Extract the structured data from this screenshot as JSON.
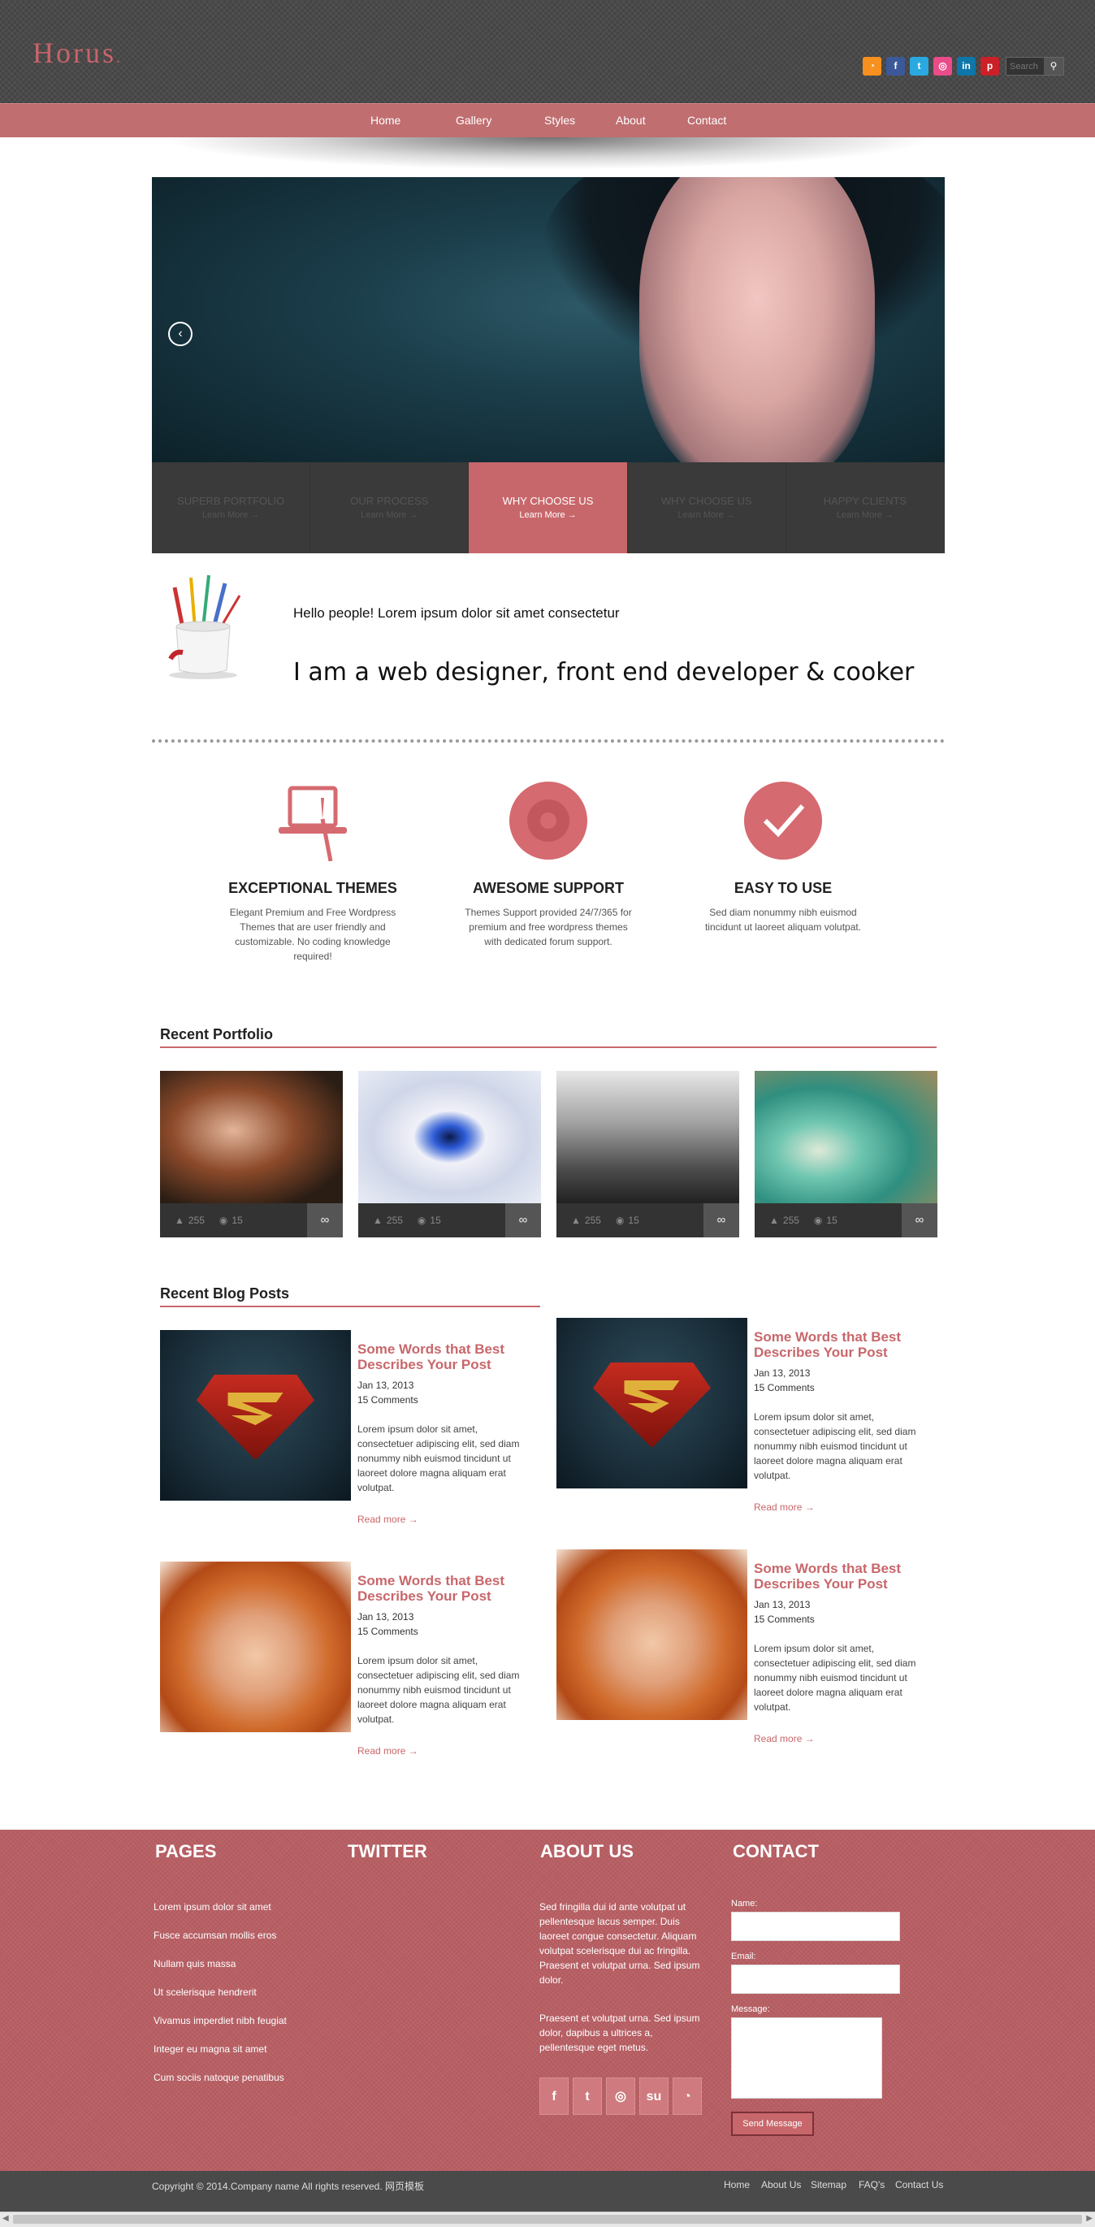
{
  "header": {
    "logo": "Horus",
    "search_placeholder": "Search",
    "social": [
      {
        "icon": "rss-icon",
        "glyph": "◔",
        "color": "#f7901e"
      },
      {
        "icon": "facebook-icon",
        "glyph": "f",
        "color": "#3b5998"
      },
      {
        "icon": "twitter-icon",
        "glyph": "t",
        "color": "#2aa9e0"
      },
      {
        "icon": "dribbble-icon",
        "glyph": "◎",
        "color": "#ea4c89"
      },
      {
        "icon": "linkedin-icon",
        "glyph": "in",
        "color": "#0e76a8"
      },
      {
        "icon": "pinterest-icon",
        "glyph": "p",
        "color": "#cb2027"
      }
    ]
  },
  "nav": [
    "Home",
    "Gallery",
    "Styles",
    "About",
    "Contact"
  ],
  "slider": {
    "prev_glyph": "‹",
    "tabs": [
      {
        "title": "SUPERB PORTFOLIO",
        "link": "Learn More →"
      },
      {
        "title": "OUR PROCESS",
        "link": "Learn More →"
      },
      {
        "title": "WHY CHOOSE US",
        "link": "Learn More →"
      },
      {
        "title": "WHY CHOOSE US",
        "link": "Learn More →"
      },
      {
        "title": "HAPPY CLIENTS",
        "link": "Learn More →"
      }
    ]
  },
  "intro": {
    "small": "Hello people! Lorem ipsum dolor sit amet consectetur",
    "big": "I am a web designer, front end developer & cooker"
  },
  "features": [
    {
      "title": "EXCEPTIONAL THEMES",
      "text": "Elegant Premium and Free Wordpress Themes that are user friendly and customizable. No coding knowledge required!"
    },
    {
      "title": "AWESOME SUPPORT",
      "text": "Themes Support provided 24/7/365 for premium and free wordpress themes with dedicated forum support."
    },
    {
      "title": "EASY TO USE",
      "text": "Sed diam nonummy nibh euismod tincidunt ut laoreet aliquam volutpat."
    }
  ],
  "portfolio": {
    "title": "Recent Portfolio",
    "items": [
      {
        "likes": "255",
        "views": "15"
      },
      {
        "likes": "255",
        "views": "15"
      },
      {
        "likes": "255",
        "views": "15"
      },
      {
        "likes": "255",
        "views": "15"
      }
    ]
  },
  "blog": {
    "title": "Recent Blog Posts",
    "posts": [
      {
        "title": "Some Words that Best Describes Your Post",
        "date": "Jan 13, 2013",
        "comments": "15 Comments",
        "text": "Lorem ipsum dolor sit amet, consectetuer adipiscing elit, sed diam nonummy nibh euismod tincidunt ut laoreet dolore magna aliquam erat volutpat.",
        "more": "Read more →"
      },
      {
        "title": "Some Words that Best Describes Your Post",
        "date": "Jan 13, 2013",
        "comments": "15 Comments",
        "text": "Lorem ipsum dolor sit amet, consectetuer adipiscing elit, sed diam nonummy nibh euismod tincidunt ut laoreet dolore magna aliquam erat volutpat.",
        "more": "Read more →"
      },
      {
        "title": "Some Words that Best Describes Your Post",
        "date": "Jan 13, 2013",
        "comments": "15 Comments",
        "text": "Lorem ipsum dolor sit amet, consectetuer adipiscing elit, sed diam nonummy nibh euismod tincidunt ut laoreet dolore magna aliquam erat volutpat.",
        "more": "Read more →"
      },
      {
        "title": "Some Words that Best Describes Your Post",
        "date": "Jan 13, 2013",
        "comments": "15 Comments",
        "text": "Lorem ipsum dolor sit amet, consectetuer adipiscing elit, sed diam nonummy nibh euismod tincidunt ut laoreet dolore magna aliquam erat volutpat.",
        "more": "Read more →"
      }
    ]
  },
  "footer": {
    "pages_title": "PAGES",
    "twitter_title": "TWITTER",
    "about_title": "ABOUT US",
    "contact_title": "CONTACT",
    "pages": [
      "Lorem ipsum dolor sit amet",
      "Fusce accumsan mollis eros",
      "Nullam quis massa",
      "Ut scelerisque hendrerit",
      "Vivamus imperdiet nibh feugiat",
      "Integer eu magna sit amet",
      "Cum sociis natoque penatibus"
    ],
    "about_p1": "Sed fringilla dui id ante volutpat ut pellentesque lacus semper. Duis laoreet congue consectetur. Aliquam volutpat scelerisque dui ac fringilla. Praesent et volutpat urna. Sed ipsum dolor.",
    "about_p2": "Praesent et volutpat urna. Sed ipsum dolor, dapibus a ultrices a, pellentesque eget metus.",
    "social": [
      "f",
      "t",
      "◎",
      "su",
      "◔"
    ],
    "name_label": "Name:",
    "email_label": "Email:",
    "message_label": "Message:",
    "send": "Send Message"
  },
  "bottom": {
    "copyright": "Copyright © 2014.Company name All rights reserved. 网页模板",
    "links": [
      "Home",
      "About Us",
      "Sitemap",
      "FAQ's",
      "Contact Us"
    ]
  }
}
